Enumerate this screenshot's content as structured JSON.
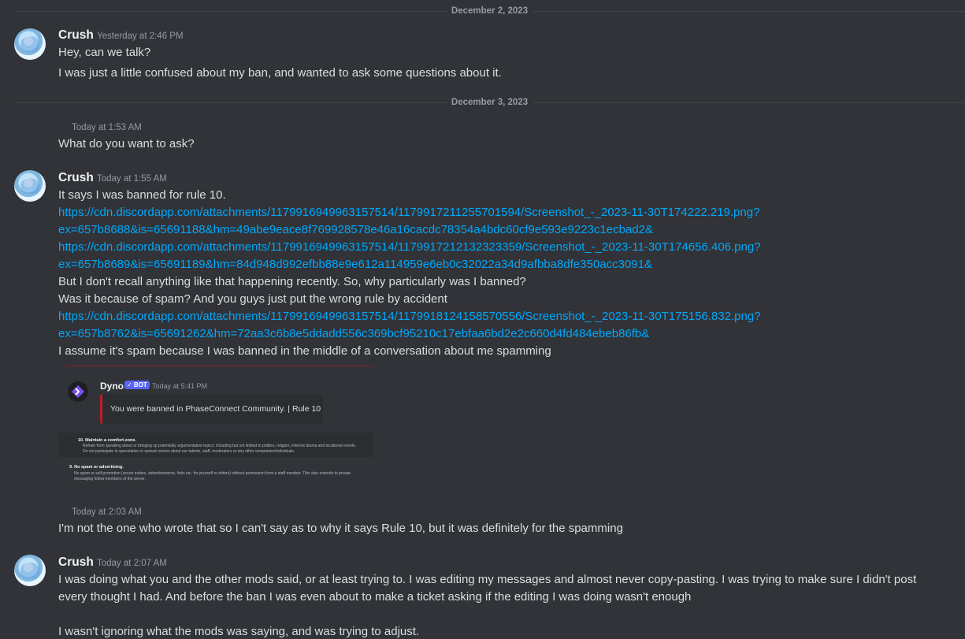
{
  "dividers": [
    "December 2, 2023",
    "December 3, 2023"
  ],
  "messages": [
    {
      "author": "Crush",
      "timestamp": "Yesterday at 2:46 PM",
      "lines": [
        "Hey, can we talk?",
        "I was just a little confused about my ban, and wanted to ask some questions about it."
      ]
    },
    {
      "timestamp": "Today at 1:53 AM",
      "lines": [
        "What do you want to ask?"
      ]
    },
    {
      "author": "Crush",
      "timestamp": "Today at 1:55 AM",
      "lines": [
        "It says I was banned for rule 10.",
        "https://cdn.discordapp.com/attachments/1179916949963157514/1179917211255701594/Screenshot_-_2023-11-30T174222.219.png?",
        "ex=657b8688&is=65691188&hm=49abe9eace8f769928578e46a16cacdc78354a4bdc60cf9e593e9223c1ecbad2&",
        "https://cdn.discordapp.com/attachments/1179916949963157514/1179917212132323359/Screenshot_-_2023-11-30T174656.406.png?",
        "ex=657b8689&is=65691189&hm=84d948d992efbb88e9e612a114959e6eb0c32022a34d9afbba8dfe350acc3091&",
        "But I don't recall anything like that happening recently. So, why particularly was I banned?",
        "Was it because of spam? And you guys just put the wrong rule by accident",
        "https://cdn.discordapp.com/attachments/1179916949963157514/1179918124158570556/Screenshot_-_2023-11-30T175156.832.png?",
        "ex=657b8762&is=65691262&hm=72aa3c6b8e5ddadd556c369bcf95210c17ebfaa6bd2e2c660d4fd484ebeb86fb&",
        "I assume it's spam because I was banned in the middle of a conversation about me spamming"
      ]
    },
    {
      "timestamp": "Today at 2:03 AM",
      "lines": [
        "I'm not the one who wrote that so I can't say as to why it says Rule 10, but it was definitely for the spamming"
      ]
    },
    {
      "author": "Crush",
      "timestamp": "Today at 2:07 AM",
      "lines": [
        "I was doing what you and the other mods said, or at least trying to. I was editing my messages and almost never copy-pasting. I was trying to make sure I didn't post",
        "every thought I had. And before the ban I was even about to make a ticket asking if the editing I was doing wasn't enough",
        "I wasn't ignoring what the mods was saying, and was trying to adjust."
      ]
    }
  ],
  "embed": {
    "bot_name": "Dyno",
    "bot_badge": "✓ BOT",
    "bot_time": "Today at 5:41 PM",
    "ban_text": "You were banned in PhaseConnect Community. | Rule 10",
    "rule10_title": "10. Maintain a comfort-zone.",
    "rule10_lines": [
      "Refrain from speaking about or bringing up potentially argumentative topics; including but not limited to politics, religion, internet drama and locational events.",
      "Do not participate in speculation or spread rumors about our talents, staff, moderators or any other companies/individuals."
    ],
    "rule9_title": "9. No spam or advertising.",
    "rule9_lines": [
      "No spam or self promotion (server invites, advertisements, links etc, for yourself or others) without permission from a staff member. This also extends to private",
      "messaging fellow members of the server."
    ]
  }
}
